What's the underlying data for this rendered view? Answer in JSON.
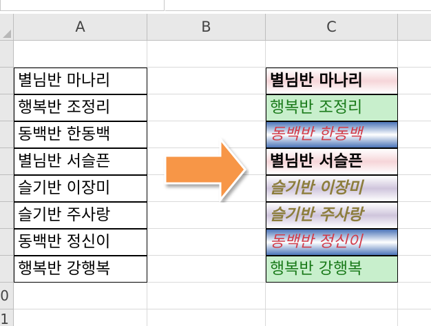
{
  "columns": [
    "A",
    "B",
    "C"
  ],
  "row_headers": [
    "0",
    "1"
  ],
  "column_a": [
    "별님반 마나리",
    "행복반 조정리",
    "동백반 한동백",
    "별님반 서슬픈",
    "슬기반 이장미",
    "슬기반 주사랑",
    "동백반 정신이",
    "행복반 강행복"
  ],
  "column_c": [
    {
      "text": "별님반 마나리",
      "style": "bold"
    },
    {
      "text": "행복반 조정리",
      "style": "green"
    },
    {
      "text": "동백반 한동백",
      "style": "blue"
    },
    {
      "text": "별님반 서슬픈",
      "style": "bold"
    },
    {
      "text": "슬기반 이장미",
      "style": "olive"
    },
    {
      "text": "슬기반 주사랑",
      "style": "olive"
    },
    {
      "text": "동백반 정신이",
      "style": "blue"
    },
    {
      "text": "행복반 강행복",
      "style": "green"
    }
  ],
  "arrow": {
    "color": "#f79646",
    "icon": "right-arrow-icon"
  },
  "colors": {
    "header_bg": "#e8e8e8",
    "grid": "#d9d9d9",
    "green_text": "#1a7a1a",
    "red_text": "#d23d4a",
    "olive_text": "#8c7d3c"
  }
}
